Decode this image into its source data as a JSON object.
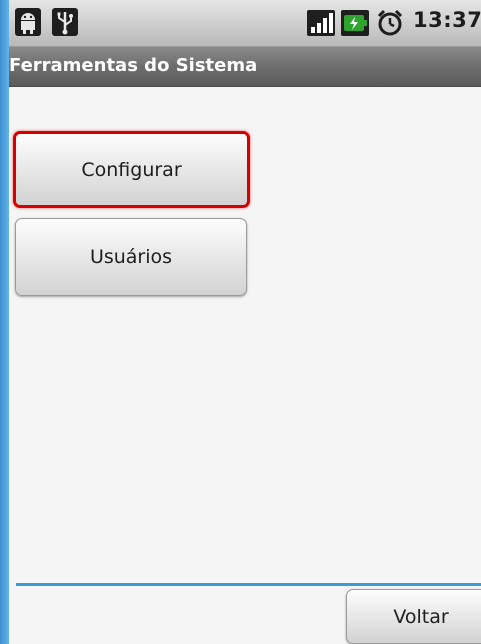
{
  "status_bar": {
    "time": "13:37",
    "icons": [
      "android-notification-icon",
      "usb-icon",
      "signal-icon",
      "battery-icon",
      "alarm-icon"
    ]
  },
  "title_bar": {
    "title": "Ferramentas do Sistema"
  },
  "main": {
    "buttons": [
      {
        "label": "Configurar",
        "focused": true
      },
      {
        "label": "Usuários",
        "focused": false
      }
    ]
  },
  "footer": {
    "back_label": "Voltar"
  },
  "colors": {
    "focus_border": "#d60000",
    "divider": "#3b9ad8",
    "frame": "#4aa3df"
  }
}
